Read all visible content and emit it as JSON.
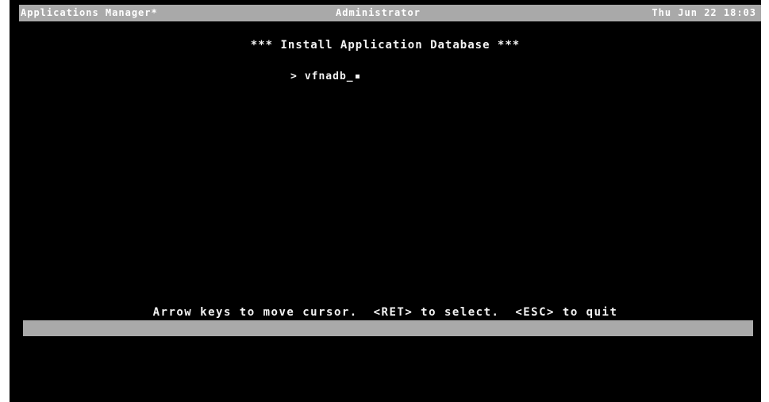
{
  "header": {
    "app_title": "Applications Manager*",
    "user": "Administrator",
    "datetime": "Thu Jun 22 18:03"
  },
  "main": {
    "title": "*** Install Application Database ***",
    "menu_items": [
      {
        "marker": ">",
        "label": "vfnadb_"
      }
    ]
  },
  "footer": {
    "help_text": "Arrow keys to move cursor.  <RET> to select.  <ESC> to quit"
  },
  "colors": {
    "background": "#000000",
    "text": "#f2f2f2",
    "bar": "#a9a9a9"
  }
}
